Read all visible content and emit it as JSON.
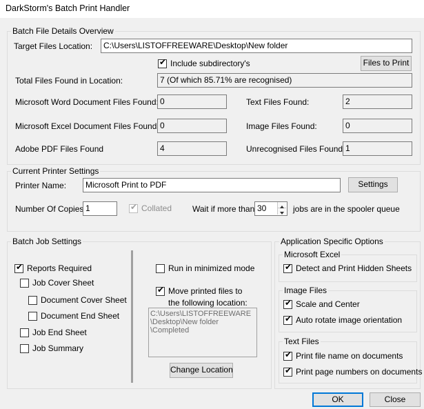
{
  "window": {
    "title": "DarkStorm's Batch Print Handler"
  },
  "overview": {
    "legend": "Batch File Details Overview",
    "target_label": "Target Files Location:",
    "target_value": "C:\\Users\\LISTOFFREEWARE\\Desktop\\New folder",
    "include_subdir_label": "Include subdirectory's",
    "include_subdir_checked": true,
    "files_to_print_label": "Files to Print",
    "total_label": "Total Files Found in Location:",
    "total_value": "7 (Of which 85.71% are recognised)",
    "word_label": "Microsoft Word Document Files Found:",
    "word_value": "0",
    "text_label": "Text Files Found:",
    "text_value": "2",
    "excel_label": "Microsoft Excel Document Files Found:",
    "excel_value": "0",
    "image_label": "Image Files Found:",
    "image_value": "0",
    "pdf_label": "Adobe PDF Files Found",
    "pdf_value": "4",
    "unrec_label": "Unrecognised Files Found:",
    "unrec_value": "1"
  },
  "printer": {
    "legend": "Current Printer Settings",
    "name_label": "Printer Name:",
    "name_value": "Microsoft Print to PDF",
    "settings_label": "Settings",
    "copies_label": "Number Of Copies:",
    "copies_value": "1",
    "collated_label": "Collated",
    "collated_checked": true,
    "wait_label": "Wait if more than",
    "wait_value": "30",
    "jobs_label": "jobs are in the spooler queue"
  },
  "batch": {
    "legend": "Batch Job Settings",
    "reports_required": "Reports Required",
    "job_cover_sheet": "Job Cover Sheet",
    "document_cover_sheet": "Document Cover Sheet",
    "document_end_sheet": "Document End Sheet",
    "job_end_sheet": "Job End Sheet",
    "job_summary": "Job Summary",
    "run_minimized": "Run in minimized mode",
    "move_printed_line1": "Move printed files to",
    "move_printed_line2": "the following location:",
    "location_lines": [
      "C:\\Users\\LISTOFFREEWARE",
      "\\Desktop\\New folder",
      "\\Completed"
    ],
    "change_location": "Change Location"
  },
  "app_options": {
    "legend": "Application Specific Options",
    "excel_legend": "Microsoft Excel",
    "detect_hidden": "Detect and Print Hidden Sheets",
    "image_legend": "Image Files",
    "scale_center": "Scale and Center",
    "auto_rotate": "Auto rotate image orientation",
    "text_legend": "Text Files",
    "print_filename": "Print file name on documents",
    "print_page_numbers": "Print page numbers on documents"
  },
  "footer": {
    "ok_label": "OK",
    "close_label": "Close"
  },
  "colors": {
    "accent": "#0078d7",
    "background": "#f0f0f0",
    "field_border": "#7a7a7a"
  }
}
